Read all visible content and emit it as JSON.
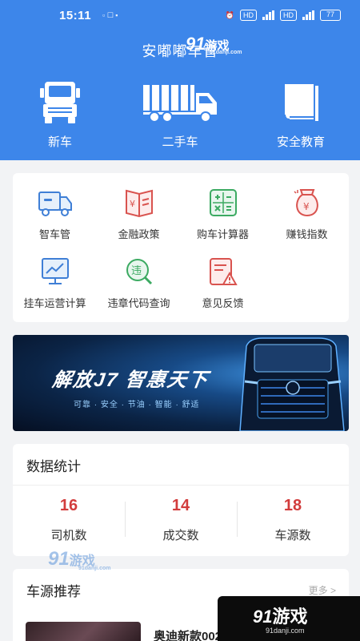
{
  "status_bar": {
    "time": "15:11",
    "battery": "77"
  },
  "header": {
    "title": "安嘟嘟车管"
  },
  "top_nav": [
    {
      "label": "新车",
      "icon": "truck-front-icon"
    },
    {
      "label": "二手车",
      "icon": "cargo-truck-icon"
    },
    {
      "label": "安全教育",
      "icon": "book-icon"
    }
  ],
  "features": [
    {
      "label": "智车管",
      "icon": "truck-icon"
    },
    {
      "label": "金融政策",
      "icon": "finance-book-icon"
    },
    {
      "label": "购车计算器",
      "icon": "calculator-icon"
    },
    {
      "label": "赚钱指数",
      "icon": "money-bag-icon"
    },
    {
      "label": "挂车运营计算",
      "icon": "chart-monitor-icon"
    },
    {
      "label": "违章代码查询",
      "icon": "violation-search-icon"
    },
    {
      "label": "意见反馈",
      "icon": "feedback-icon"
    }
  ],
  "banner": {
    "slogan": "解放J7  智惠天下",
    "tagline": "可靠 · 安全 · 节油 · 智能 · 舒适"
  },
  "stats": {
    "title": "数据统计",
    "items": [
      {
        "value": "16",
        "label": "司机数"
      },
      {
        "value": "14",
        "label": "成交数"
      },
      {
        "value": "18",
        "label": "车源数"
      }
    ]
  },
  "recommend": {
    "title": "车源推荐",
    "more": "更多 >",
    "items": [
      {
        "name": "奥迪新款002"
      }
    ]
  },
  "watermark": {
    "brand_num": "91",
    "brand_cn": "游戏",
    "url": "91danji.com"
  },
  "colors": {
    "primary": "#3d86ea",
    "stat_number": "#d23c3c",
    "icon_red": "#d9534f",
    "icon_blue": "#3f7fd6",
    "icon_green": "#3caa62"
  }
}
